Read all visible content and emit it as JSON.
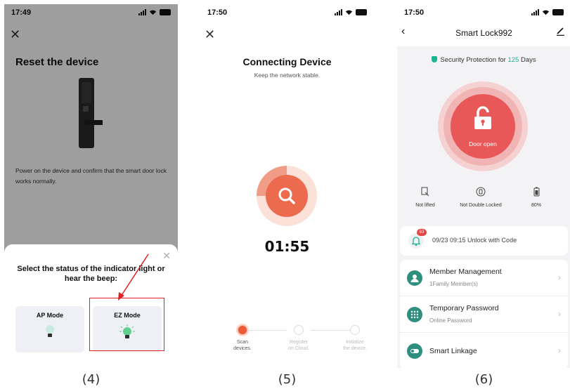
{
  "screen1": {
    "time": "17:49",
    "title": "Reset the device",
    "description": "Power on the device and confirm that the smart door lock works normally.",
    "sheet": {
      "prompt": "Select the status of the indicator light or hear the beep:",
      "modes": [
        {
          "label": "AP Mode"
        },
        {
          "label": "EZ Mode"
        }
      ]
    },
    "caption": "(4)"
  },
  "screen2": {
    "time": "17:50",
    "title": "Connecting Device",
    "subtitle": "Keep the network stable.",
    "timer": "01:55",
    "steps": [
      {
        "line1": "Scan",
        "line2": "devices."
      },
      {
        "line1": "Register",
        "line2": "on Cloud."
      },
      {
        "line1": "Initialize",
        "line2": "the device."
      }
    ],
    "caption": "(5)"
  },
  "screen3": {
    "time": "17:50",
    "device_name": "Smart Lock992",
    "security_prefix": "Security Protection for ",
    "security_days": "125",
    "security_suffix": " Days",
    "door_status": "Door open",
    "stats": [
      {
        "label": "Not lifted",
        "icon": "lift-sensor-icon"
      },
      {
        "label": "Not Double Locked",
        "icon": "double-lock-icon"
      },
      {
        "label": "80%",
        "icon": "battery-icon"
      }
    ],
    "notification": {
      "badge": "63",
      "text": "09/23 09:15 Unlock with Code"
    },
    "menu": [
      {
        "title": "Member Management",
        "subtitle": "1Family Member(s)",
        "icon": "member-icon"
      },
      {
        "title": "Temporary Password",
        "subtitle": "Online Password",
        "icon": "keypad-icon"
      },
      {
        "title": "Smart Linkage",
        "subtitle": "",
        "icon": "toggle-icon"
      }
    ],
    "caption": "(6)"
  },
  "colors": {
    "accent_red": "#e85858",
    "accent_orange": "#ec5a3a",
    "accent_teal": "#2e8f7f",
    "highlight_red": "#e02020"
  }
}
